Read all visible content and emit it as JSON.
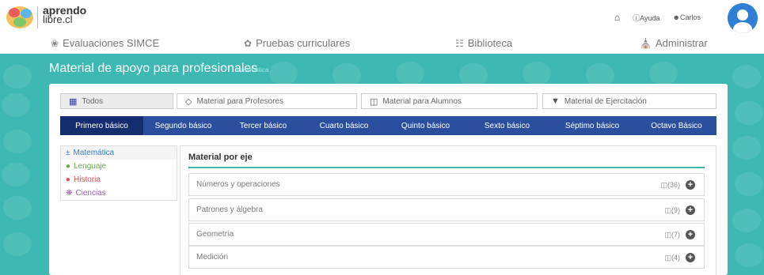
{
  "brand": {
    "logo_line1": "aprendo",
    "logo_line2": "libre.cl"
  },
  "topnav": {
    "help_label": "ⓘAyuda",
    "user_label": "☻Carlos"
  },
  "mainnav": {
    "items": [
      {
        "label": "Evaluaciones SIMCE",
        "icon": "medal-icon"
      },
      {
        "label": "Pruebas curriculares",
        "icon": "ribbon-icon"
      },
      {
        "label": "Biblioteca",
        "icon": "book-icon"
      },
      {
        "label": "Administrar",
        "icon": "building-icon"
      }
    ]
  },
  "section": {
    "title": "Material de apoyo para profesionales",
    "subtitle": "Matemática"
  },
  "filters": [
    {
      "label": "Todos",
      "icon": "grid-icon",
      "active": true
    },
    {
      "label": "Material para Profesores",
      "icon": "graduation-cap-icon",
      "active": false
    },
    {
      "label": "Material para Alumnos",
      "icon": "open-book-icon",
      "active": false
    },
    {
      "label": "Material de Ejercitación",
      "icon": "tag-icon",
      "active": false
    }
  ],
  "grades": [
    "Primero básico",
    "Segundo básico",
    "Tercer básico",
    "Cuarto básico",
    "Quinto básico",
    "Sexto básico",
    "Séptimo básico",
    "Octavo Básico"
  ],
  "active_grade": "Primero básico",
  "subjects": [
    {
      "label": "Matemática",
      "icon": "math-icon",
      "color": "#2f7fd4",
      "active": true
    },
    {
      "label": "Lenguaje",
      "icon": "speech-bubble-icon",
      "color": "#6aa84f",
      "active": false
    },
    {
      "label": "Historia",
      "icon": "globe-icon",
      "color": "#d9534f",
      "active": false
    },
    {
      "label": "Ciencias",
      "icon": "atom-icon",
      "color": "#9b59b6",
      "active": false
    }
  ],
  "eje": {
    "title": "Material por eje",
    "rows": [
      {
        "name": "Números y operaciones",
        "count": "(36)"
      },
      {
        "name": "Patrones y álgebra",
        "count": "(9)"
      },
      {
        "name": "Geometría",
        "count": "(7)"
      },
      {
        "name": "Medición",
        "count": "(4)"
      }
    ]
  },
  "colors": {
    "teal": "#3db8b3",
    "navy": "#2b4e9f",
    "navy_active": "#132d6e"
  }
}
